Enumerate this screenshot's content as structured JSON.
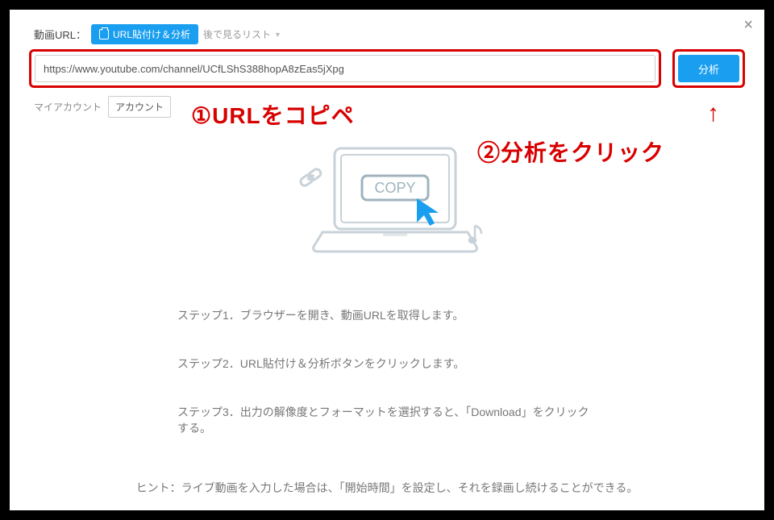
{
  "header": {
    "url_label": "動画URL：",
    "paste_button": "URL貼付け＆分析",
    "later_list": "後で見るリスト"
  },
  "url_input": {
    "value": "https://www.youtube.com/channel/UCfLShS388hopA8zEas5jXpg"
  },
  "analyze_button": "分析",
  "account": {
    "my_account": "マイアカウント",
    "account_button": "アカウント"
  },
  "annotations": {
    "copy_url": "①URLをコピペ",
    "click_analyze": "②分析をクリック",
    "arrow": "↑"
  },
  "illustration": {
    "copy_label": "COPY"
  },
  "steps": {
    "s1": "ステップ1．ブラウザーを開き、動画URLを取得します。",
    "s2": "ステップ2．URL貼付け＆分析ボタンをクリックします。",
    "s3": "ステップ3．出力の解像度とフォーマットを選択すると、「Download」をクリックする。"
  },
  "hint": "ヒント：ライブ動画を入力した場合は、「開始時間」を設定し、それを録画し続けることができる。"
}
